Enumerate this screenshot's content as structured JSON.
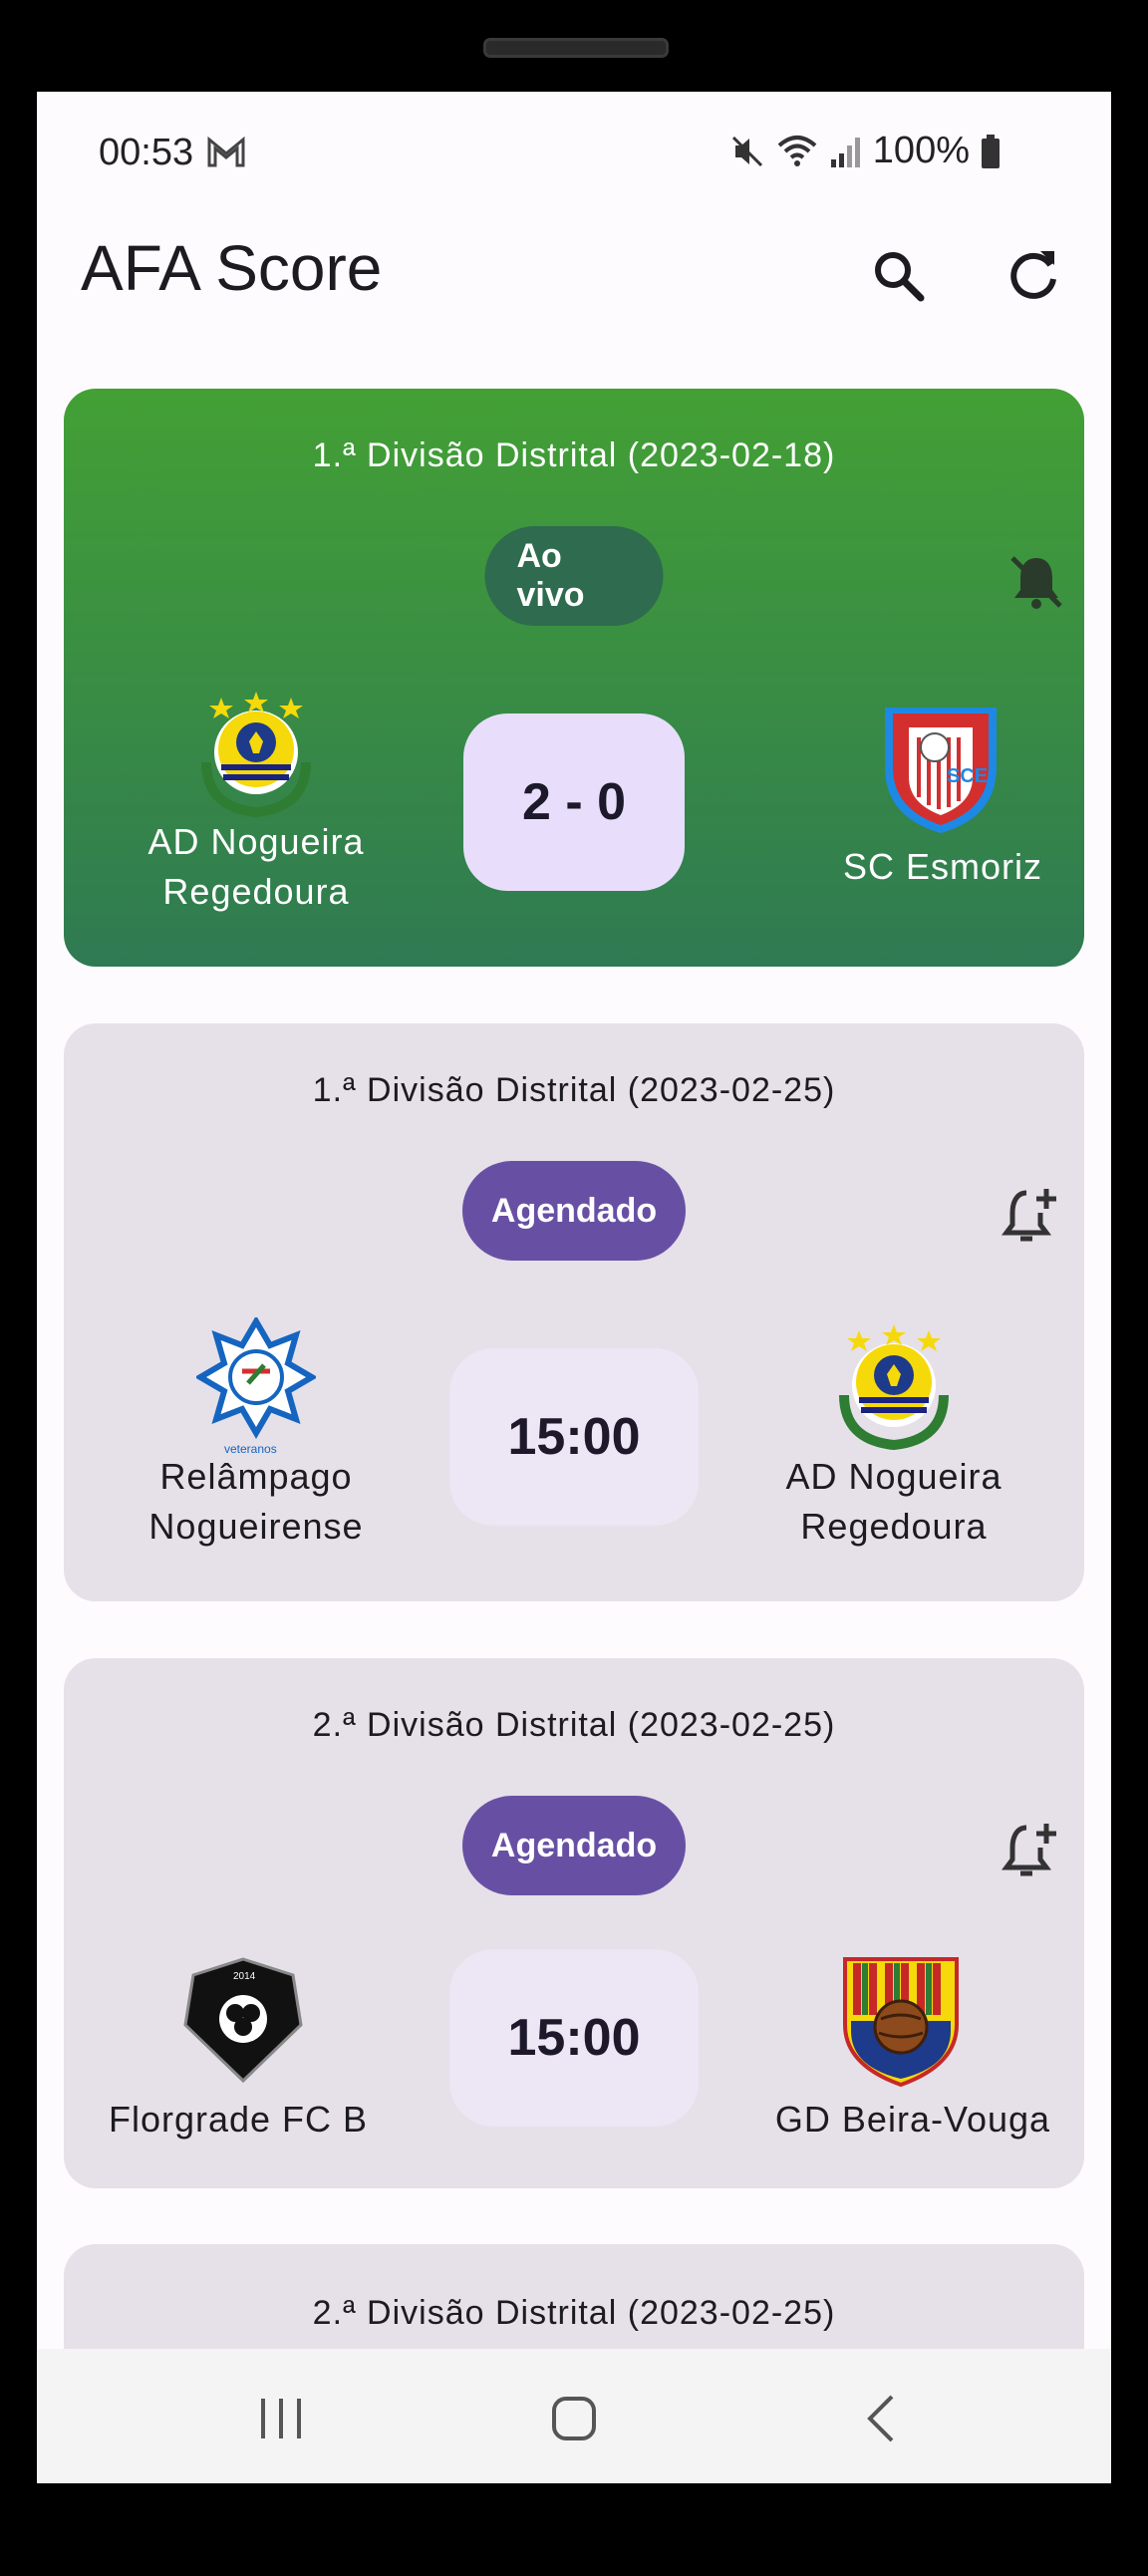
{
  "status": {
    "time": "00:53",
    "battery": "100%"
  },
  "app": {
    "title": "AFA Score"
  },
  "matches": [
    {
      "competition": "1.ª Divisão Distrital (2023-02-18)",
      "state": "Ao vivo",
      "home": "AD Nogueira\nRegedoura",
      "away": "SC Esmoriz",
      "score": "2 - 0"
    },
    {
      "competition": "1.ª Divisão Distrital (2023-02-25)",
      "state": "Agendado",
      "home": "Relâmpago\nNogueirense",
      "away": "AD Nogueira\nRegedoura",
      "score": "15:00"
    },
    {
      "competition": "2.ª Divisão Distrital (2023-02-25)",
      "state": "Agendado",
      "home": "Florgrade FC B",
      "away": "GD Beira-Vouga",
      "score": "15:00"
    },
    {
      "competition": "2.ª Divisão Distrital (2023-02-25)"
    }
  ],
  "colors": {
    "live_top": "#43a035",
    "live_bottom": "#2f7a52",
    "scheduled_pill": "#6750a4",
    "card_bg": "#e6e0e9"
  }
}
